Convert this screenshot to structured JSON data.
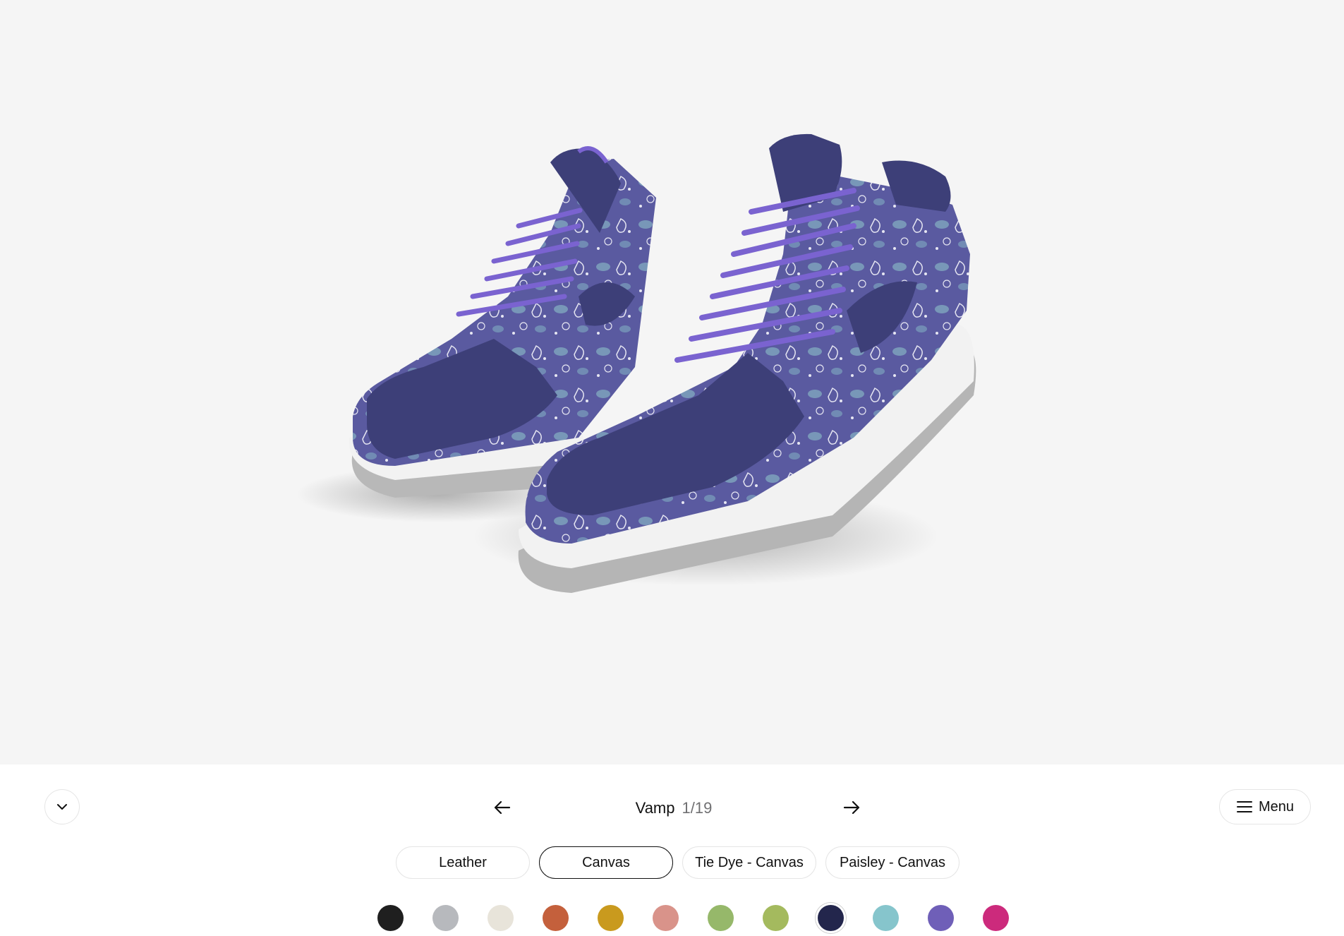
{
  "product": {
    "upper_color": "#3d3f78",
    "paisley_base": "#5a5aa0",
    "lace_color": "#7a63d0",
    "sole_color": "#f2f2f2",
    "outsole_color": "#b5b5b5"
  },
  "nav": {
    "step_name": "Vamp",
    "step_count": "1/19",
    "prev_icon": "arrow-left-icon",
    "next_icon": "arrow-right-icon",
    "collapse_icon": "chevron-down-icon"
  },
  "menu": {
    "label": "Menu",
    "icon": "hamburger-icon"
  },
  "materials": [
    {
      "label": "Leather",
      "selected": false
    },
    {
      "label": "Canvas",
      "selected": true
    },
    {
      "label": "Tie Dye - Canvas",
      "selected": false
    },
    {
      "label": "Paisley - Canvas",
      "selected": false
    }
  ],
  "swatches": [
    {
      "color": "#1f1f1f",
      "selected": false
    },
    {
      "color": "#b7b9bd",
      "selected": false
    },
    {
      "color": "#e8e4da",
      "selected": false
    },
    {
      "color": "#c4603c",
      "selected": false
    },
    {
      "color": "#c99a1e",
      "selected": false
    },
    {
      "color": "#d9938a",
      "selected": false
    },
    {
      "color": "#96b86a",
      "selected": false
    },
    {
      "color": "#a4ba5e",
      "selected": false
    },
    {
      "color": "#23264c",
      "selected": true
    },
    {
      "color": "#86c5cc",
      "selected": false
    },
    {
      "color": "#6f5fb8",
      "selected": false
    },
    {
      "color": "#cc2a7c",
      "selected": false
    }
  ]
}
